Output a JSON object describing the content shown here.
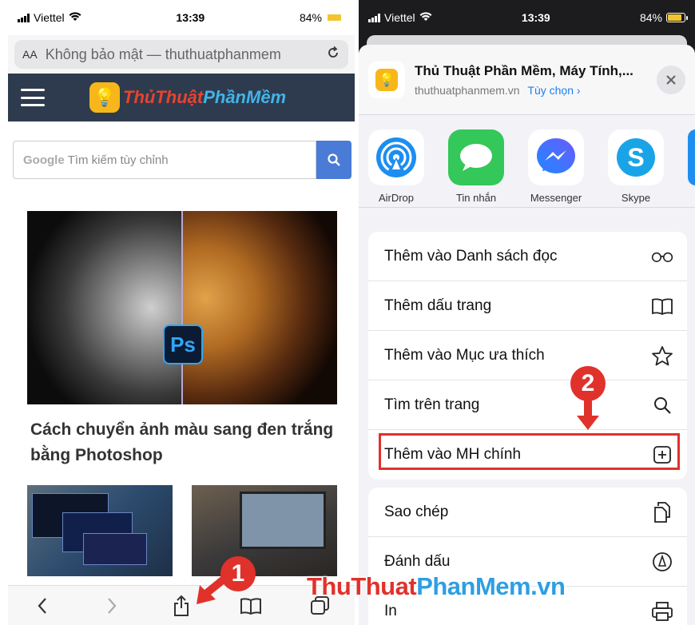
{
  "left": {
    "status": {
      "carrier": "Viettel",
      "time": "13:39",
      "battery": "84%"
    },
    "urlbar": {
      "aa": "AA",
      "url": "Không bảo mật — thuthuatphanmem"
    },
    "logo": {
      "part1": "ThủThuật",
      "part2": "PhầnMềm"
    },
    "search": {
      "brand": "Google",
      "placeholder": "Tìm kiếm tùy chỉnh"
    },
    "hero": {
      "ps_label": "Ps"
    },
    "article_title": "Cách chuyển ảnh màu sang đen trắng bằng Photoshop",
    "badge": "1"
  },
  "right": {
    "status": {
      "carrier": "Viettel",
      "time": "13:39",
      "battery": "84%"
    },
    "share": {
      "title": "Thủ Thuật Phần Mềm, Máy Tính,...",
      "domain": "thuthuatphanmem.vn",
      "options": "Tùy chọn ›"
    },
    "apps": [
      {
        "label": "AirDrop",
        "icon": "airdrop-icon"
      },
      {
        "label": "Tin nhắn",
        "icon": "messages-icon"
      },
      {
        "label": "Messenger",
        "icon": "messenger-icon"
      },
      {
        "label": "Skype",
        "icon": "skype-icon"
      }
    ],
    "actions1": [
      {
        "label": "Thêm vào Danh sách đọc",
        "icon": "glasses-icon"
      },
      {
        "label": "Thêm dấu trang",
        "icon": "book-icon"
      },
      {
        "label": "Thêm vào Mục ưa thích",
        "icon": "star-icon"
      },
      {
        "label": "Tìm trên trang",
        "icon": "search-icon"
      },
      {
        "label": "Thêm vào MH chính",
        "icon": "add-square-icon"
      }
    ],
    "actions2": [
      {
        "label": "Sao chép",
        "icon": "copy-icon"
      },
      {
        "label": "Đánh dấu",
        "icon": "markup-icon"
      },
      {
        "label": "In",
        "icon": "print-icon"
      }
    ],
    "badge": "2"
  },
  "watermark": {
    "part1": "ThuThuat",
    "part2": "PhanMem",
    "part3": ".vn"
  },
  "colors": {
    "accent_red": "#e1312b",
    "ios_blue": "#1a7ff0",
    "header_dark": "#2e3b4e"
  }
}
